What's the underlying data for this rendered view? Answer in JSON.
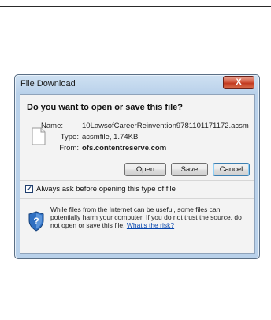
{
  "dialog": {
    "title": "File Download",
    "close_label": "X",
    "question": "Do you want to open or save this file?",
    "file": {
      "name_label": "Name:",
      "name_value": "10LawsofCareerReinvention9781101171172.acsm",
      "type_label": "Type:",
      "type_value": "acsmfile, 1.74KB",
      "from_label": "From:",
      "from_value": "ofs.contentreserve.com"
    },
    "buttons": {
      "open": "Open",
      "save": "Save",
      "cancel": "Cancel"
    },
    "checkbox": {
      "label": "Always ask before opening this type of file",
      "checked": true
    },
    "warning": {
      "text": "While files from the Internet can be useful, some files can potentially harm your computer. If you do not trust the source, do not open or save this file.",
      "link": "What's the risk?"
    }
  },
  "icons": {
    "file": "generic-file-icon",
    "security": "shield-warning-icon"
  }
}
